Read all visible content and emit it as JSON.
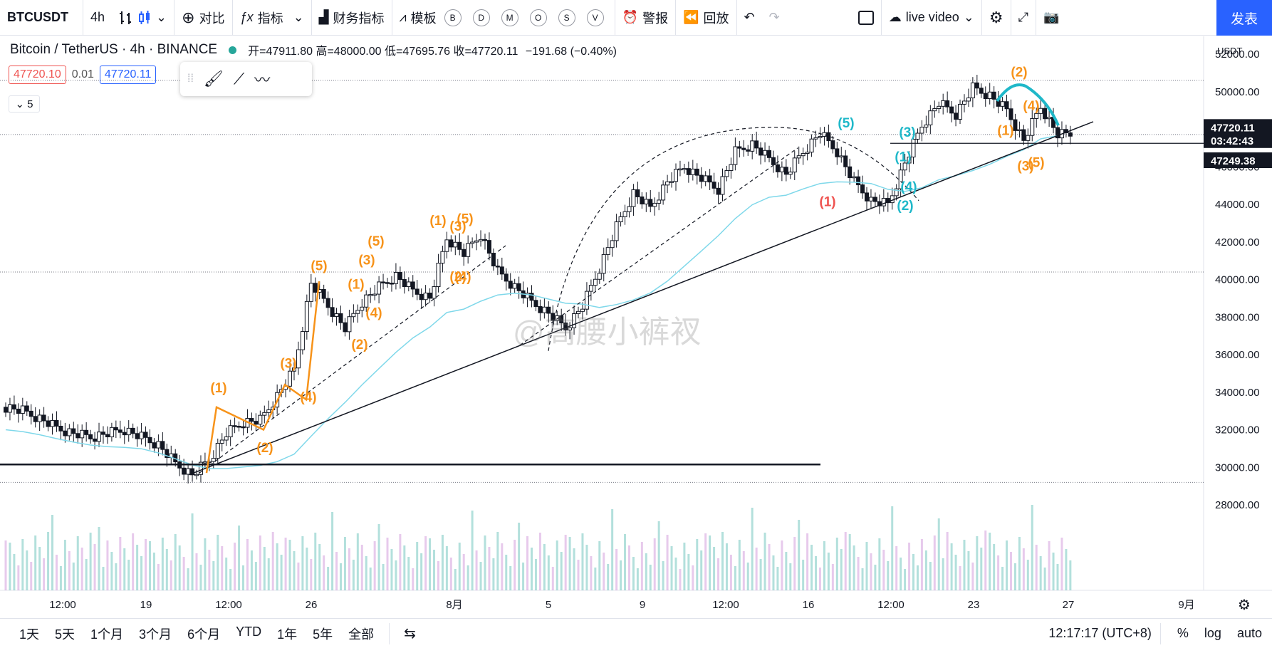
{
  "toolbar": {
    "symbol": "BTCUSDT",
    "interval": "4h",
    "compare": "对比",
    "indicators": "指标",
    "financials": "财务指标",
    "templates": "模板",
    "letters": [
      "B",
      "D",
      "M",
      "O",
      "S",
      "V"
    ],
    "alert": "警报",
    "replay": "回放",
    "layout_name": "live video",
    "publish": "发表"
  },
  "legend": {
    "title": "Bitcoin / TetherUS · 4h · BINANCE",
    "open": "开=47911.80",
    "high": "高=48000.00",
    "low": "低=47695.76",
    "close": "收=47720.11",
    "change": "−191.68 (−0.40%)"
  },
  "price_boxes": {
    "bid": "47720.10",
    "spread": "0.01",
    "ask": "47720.11"
  },
  "collapse_count": "5",
  "watermark": "@高腰小裤衩",
  "bottom": {
    "ranges": [
      "1天",
      "5天",
      "1个月",
      "3个月",
      "6个月",
      "YTD",
      "1年",
      "5年",
      "全部"
    ],
    "time": "12:17:17 (UTC+8)",
    "pct": "%",
    "log": "log",
    "auto": "auto"
  },
  "colors": {
    "up": "#26a69a",
    "down": "#ef5350",
    "wave": "#f7931a",
    "wave2": "#1fb8c9",
    "ma": "#7fd8ea",
    "accent": "#2962ff"
  },
  "chart_data": {
    "type": "candlestick",
    "currency": "USDT",
    "price_ticks": [
      28000,
      30000,
      32000,
      34000,
      36000,
      38000,
      40000,
      42000,
      44000,
      46000,
      48000,
      50000,
      52000
    ],
    "time_ticks": [
      "12:00",
      "19",
      "12:00",
      "26",
      "8月",
      "5",
      "9",
      "12:00",
      "16",
      "12:00",
      "23",
      "27",
      "9月"
    ],
    "last_price": "47720.11",
    "countdown": "03:42:43",
    "level_price": "47249.38",
    "close_series": [
      33200,
      33000,
      32600,
      32100,
      31800,
      31600,
      31800,
      32000,
      31600,
      31200,
      30200,
      29600,
      30400,
      31800,
      32400,
      32500,
      33800,
      35200,
      39800,
      38600,
      37400,
      38800,
      39600,
      40200,
      39400,
      39000,
      42200,
      41400,
      42400,
      40400,
      39600,
      38800,
      38200,
      37400,
      38600,
      40600,
      42800,
      44600,
      43800,
      45200,
      46000,
      45400,
      44800,
      46800,
      47200,
      46400,
      45600,
      46800,
      47800,
      46800,
      45200,
      44200,
      44000,
      46200,
      48200,
      49400,
      48800,
      50200,
      49800,
      49000,
      47400,
      49200,
      47720
    ],
    "wave_labels": [
      "(1)",
      "(2)",
      "(3)",
      "(4)",
      "(5)",
      "(1)",
      "(2)",
      "(3)",
      "(4)",
      "(5)",
      "(1)",
      "(3)",
      "(5)",
      "(2)",
      "(4)",
      "(1)",
      "(3)",
      "(2)",
      "(5)",
      "(4)",
      "(2)"
    ],
    "series": [
      {
        "name": "MA",
        "type": "line"
      },
      {
        "name": "Volume",
        "type": "bar"
      }
    ],
    "grid": false
  }
}
